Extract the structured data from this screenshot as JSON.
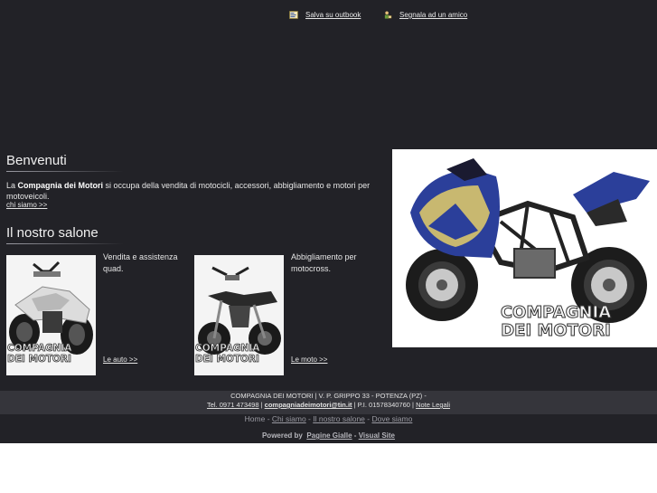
{
  "top_links": {
    "outlook": "Salva su outbook",
    "friend": "Segnala ad un amico"
  },
  "welcome": {
    "title": "Benvenuti",
    "text_prefix": "La ",
    "company": "Compagnia dei Motori",
    "text_suffix": " si occupa della vendita di motocicli, accessori, abbigliamento e motori per motoveicoli.",
    "link": "chi siamo >>"
  },
  "salone": {
    "title": "Il nostro salone",
    "items": [
      {
        "desc": "Vendita e assistenza quad.",
        "link": "Le auto >>",
        "image_text": "COMPAGNIA DEI MOTORI"
      },
      {
        "desc": "Abbigliamento per motocross.",
        "link": "Le moto >>",
        "image_text": "COMPAGNIA DEI MOTORI"
      }
    ]
  },
  "hero": {
    "logo_line1": "COMPAGNIA",
    "logo_line2": "DEI MOTORI"
  },
  "footer": {
    "line1": "COMPAGNIA DEI MOTORI | V. P. GRIPPO 33 - POTENZA (PZ) -",
    "phone": "Tel. 0971 473498",
    "sep1": " | ",
    "email": "compagniadeimotori@tin.it",
    "sep2": " | P.I. 01578340760 | ",
    "legal": "Note Legali"
  },
  "nav": {
    "home": "Home",
    "chi_siamo": "Chi siamo",
    "salone": "Il nostro salone",
    "dove": "Dove siamo",
    "sep": " - "
  },
  "powered": {
    "label": "Powered by",
    "pagine": "Pagine Gialle",
    "dash": " - ",
    "visual": "Visual Site"
  },
  "colors": {
    "background": "#222227",
    "footer_bar": "#35353b",
    "text": "#e6e6e6"
  }
}
